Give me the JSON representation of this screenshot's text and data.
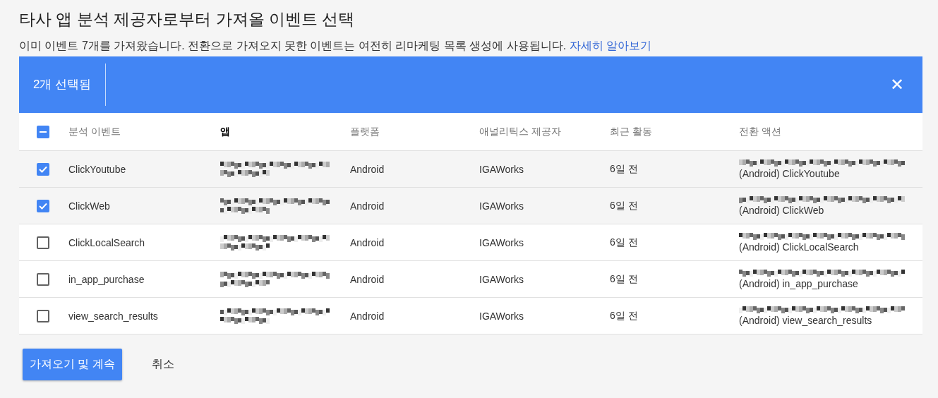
{
  "title": "타사 앱 분석 제공자로부터 가져올 이벤트 선택",
  "subtitle": {
    "text": "이미 이벤트 7개를 가져왔습니다. 전환으로 가져오지 못한 이벤트는 여전히 리마케팅 목록 생성에 사용됩니다.",
    "link": "자세히 알아보기"
  },
  "selection_bar": {
    "label": "2개 선택됨",
    "close": "✕"
  },
  "table": {
    "header_checkbox": {
      "indeterminate": true
    },
    "columns": [
      {
        "label": "분석 이벤트",
        "bold": false
      },
      {
        "label": "앱",
        "bold": true
      },
      {
        "label": "플랫폼",
        "bold": false
      },
      {
        "label": "애널리틱스 제공자",
        "bold": false
      },
      {
        "label": "최근 활동",
        "bold": false
      },
      {
        "label": "전환 액션",
        "bold": false
      }
    ],
    "rows": [
      {
        "checked": true,
        "event": "ClickYoutube",
        "platform": "Android",
        "provider": "IGAWorks",
        "recent": "6일 전",
        "conversion": "(Android) ClickYoutube"
      },
      {
        "checked": true,
        "event": "ClickWeb",
        "platform": "Android",
        "provider": "IGAWorks",
        "recent": "6일 전",
        "conversion": "(Android) ClickWeb"
      },
      {
        "checked": false,
        "event": "ClickLocalSearch",
        "platform": "Android",
        "provider": "IGAWorks",
        "recent": "6일 전",
        "conversion": "(Android) ClickLocalSearch"
      },
      {
        "checked": false,
        "event": "in_app_purchase",
        "platform": "Android",
        "provider": "IGAWorks",
        "recent": "6일 전",
        "conversion": "(Android) in_app_purchase"
      },
      {
        "checked": false,
        "event": "view_search_results",
        "platform": "Android",
        "provider": "IGAWorks",
        "recent": "6일 전",
        "conversion": "(Android) view_search_results"
      }
    ]
  },
  "buttons": [
    {
      "kind": "primary",
      "label": "가져오기 및 계속"
    },
    {
      "kind": "text",
      "label": "취소"
    }
  ]
}
